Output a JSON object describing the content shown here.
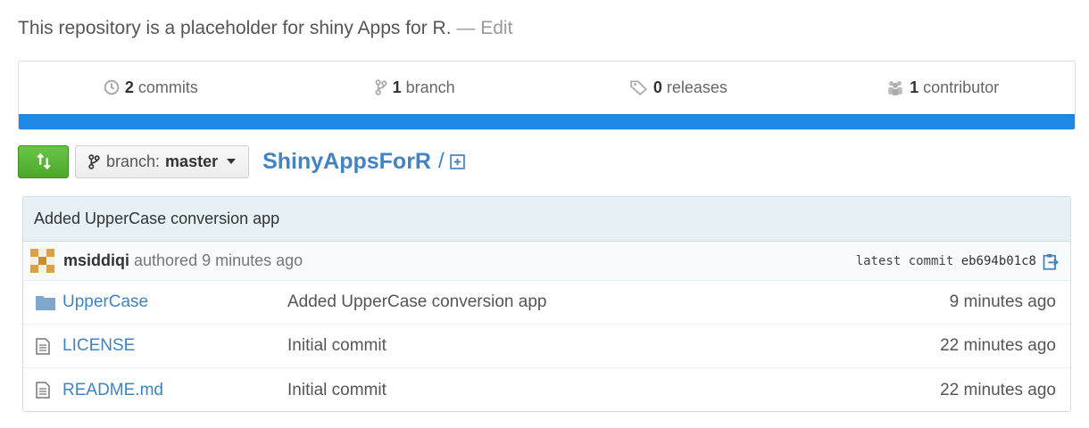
{
  "description": {
    "text": "This repository is a placeholder for shiny Apps for R.",
    "separator": "—",
    "edit_label": "Edit"
  },
  "summary": {
    "commits": {
      "count": "2",
      "label": "commits",
      "icon": "history-icon"
    },
    "branches": {
      "count": "1",
      "label": "branch",
      "icon": "branch-icon"
    },
    "releases": {
      "count": "0",
      "label": "releases",
      "icon": "tag-icon"
    },
    "contributors": {
      "count": "1",
      "label": "contributor",
      "icon": "organization-icon"
    },
    "language_bar_color": "#1e88e5"
  },
  "toolbar": {
    "compare_icon": "compare-icon",
    "branch_prefix": "branch:",
    "branch_name": "master",
    "repo_name": "ShinyAppsForR",
    "separator": "/"
  },
  "latest_commit": {
    "message": "Added UpperCase conversion app",
    "author": "msiddiqi",
    "authored_text": "authored 9 minutes ago",
    "latest_label": "latest commit",
    "sha": "eb694b01c8"
  },
  "files": [
    {
      "type": "directory",
      "icon": "folder-icon",
      "name": "UpperCase",
      "message": "Added UpperCase conversion app",
      "age": "9 minutes ago"
    },
    {
      "type": "file",
      "icon": "file-text-icon",
      "name": "LICENSE",
      "message": "Initial commit",
      "age": "22 minutes ago"
    },
    {
      "type": "file",
      "icon": "file-text-icon",
      "name": "README.md",
      "message": "Initial commit",
      "age": "22 minutes ago"
    }
  ],
  "colors": {
    "link": "#4183c4",
    "accent_green": "#55a532",
    "commit_bg": "#e6f1f6"
  }
}
